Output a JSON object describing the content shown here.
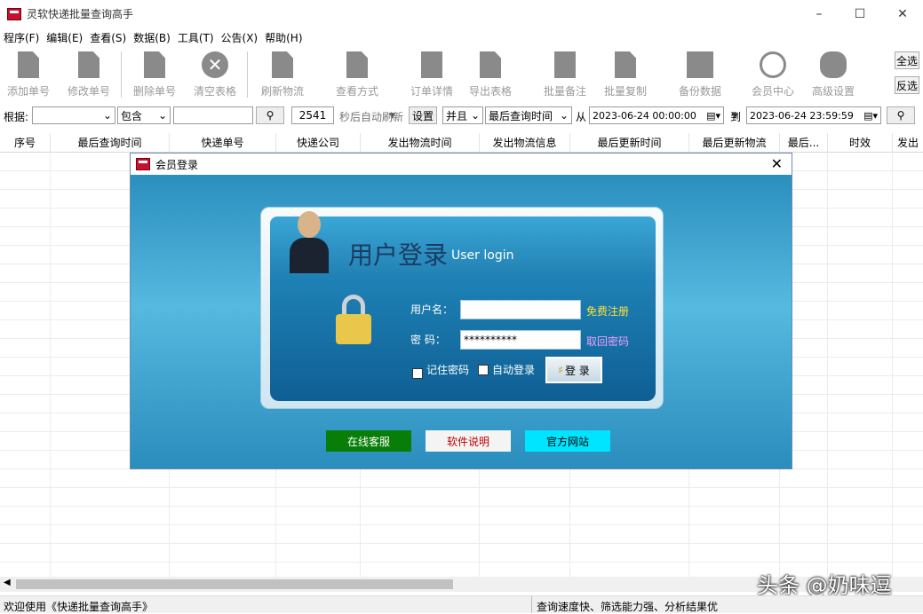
{
  "window": {
    "title": "灵软快递批量查询高手"
  },
  "menu": [
    "程序(F)",
    "编辑(E)",
    "查看(S)",
    "数据(B)",
    "工具(T)",
    "公告(X)",
    "帮助(H)"
  ],
  "toolbar": {
    "items": [
      "添加单号",
      "修改单号",
      "删除单号",
      "清空表格",
      "刷新物流",
      "查看方式",
      "订单详情",
      "导出表格",
      "批量备注",
      "批量复制",
      "备份数据",
      "会员中心",
      "高级设置"
    ],
    "select_all": "全选",
    "invert": "反选"
  },
  "filter": {
    "basis_label": "根据:",
    "basis_value": "",
    "contains": "包含",
    "keyword": "",
    "refresh_seconds": "2541",
    "auto_refresh_label": "秒后自动刷新",
    "set_button": "设置",
    "logic": "并且",
    "time_field": "最后查询时间",
    "from_label": "从",
    "from_value": "2023-06-24 00:00:00",
    "to_label": "到",
    "to_value": "2023-06-24 23:59:59"
  },
  "table": {
    "columns": [
      "序号",
      "最后查询时间",
      "快递单号",
      "快递公司",
      "发出物流时间",
      "发出物流信息",
      "最后更新时间",
      "最后更新物流",
      "最后...",
      "时效",
      "发出"
    ]
  },
  "status": {
    "left": "欢迎使用《快递批量查询高手》",
    "right": "查询速度快、筛选能力强、分析结果优"
  },
  "watermark": "头条 @奶味逗",
  "login": {
    "title": "会员登录",
    "heading_cn": "用户登录",
    "heading_en": "User login",
    "username_label": "用户名：",
    "username_value": "",
    "password_label": "密  码：",
    "password_value": "**********",
    "register_link": "免费注册",
    "recover_link": "取回密码",
    "remember_label": "记住密码",
    "remember_checked": true,
    "autologin_label": "自动登录",
    "autologin_checked": false,
    "login_button": "登 录",
    "online_service": "在线客服",
    "software_help": "软件说明",
    "official_site": "官方网站"
  },
  "colors": {
    "online": "#087d08",
    "help_text": "#c00000",
    "site": "#00e5ff",
    "link_yellow": "#ffe23a",
    "link_pink": "#f0a0ff"
  }
}
